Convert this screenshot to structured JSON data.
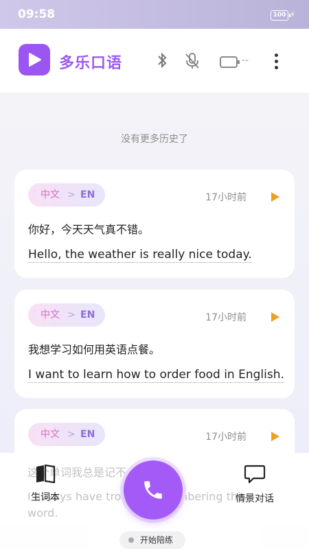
{
  "status_bar": {
    "time": "09:58",
    "battery": "100"
  },
  "header": {
    "app_title": "多乐口语",
    "device_status": "--"
  },
  "history_note": "没有更多历史了",
  "cards": [
    {
      "src_lang": "中文",
      "sep": ">",
      "dst_lang": "EN",
      "time": "17小时前",
      "src": "你好，今天天气真不错。",
      "dst": "Hello, the weather is really nice today."
    },
    {
      "src_lang": "中文",
      "sep": ">",
      "dst_lang": "EN",
      "time": "17小时前",
      "src": "我想学习如何用英语点餐。",
      "dst": "I want to learn how to order food in English."
    },
    {
      "src_lang": "中文",
      "sep": ">",
      "dst_lang": "EN",
      "time": "17小时前",
      "src": "这个单词我总是记不住",
      "dst": "I always have trouble remembering this word."
    }
  ],
  "bottom_nav": {
    "words_label": "生词本",
    "scene_label": "情景对话",
    "start_label": "开始陪练"
  },
  "colors": {
    "brand": "#9b55f3",
    "accent": "#f0a020"
  },
  "icons": [
    "bluetooth-icon",
    "mic-off-icon",
    "device-icon",
    "more-icon",
    "play-icon",
    "book-icon",
    "chat-bubble-icon",
    "phone-icon"
  ]
}
